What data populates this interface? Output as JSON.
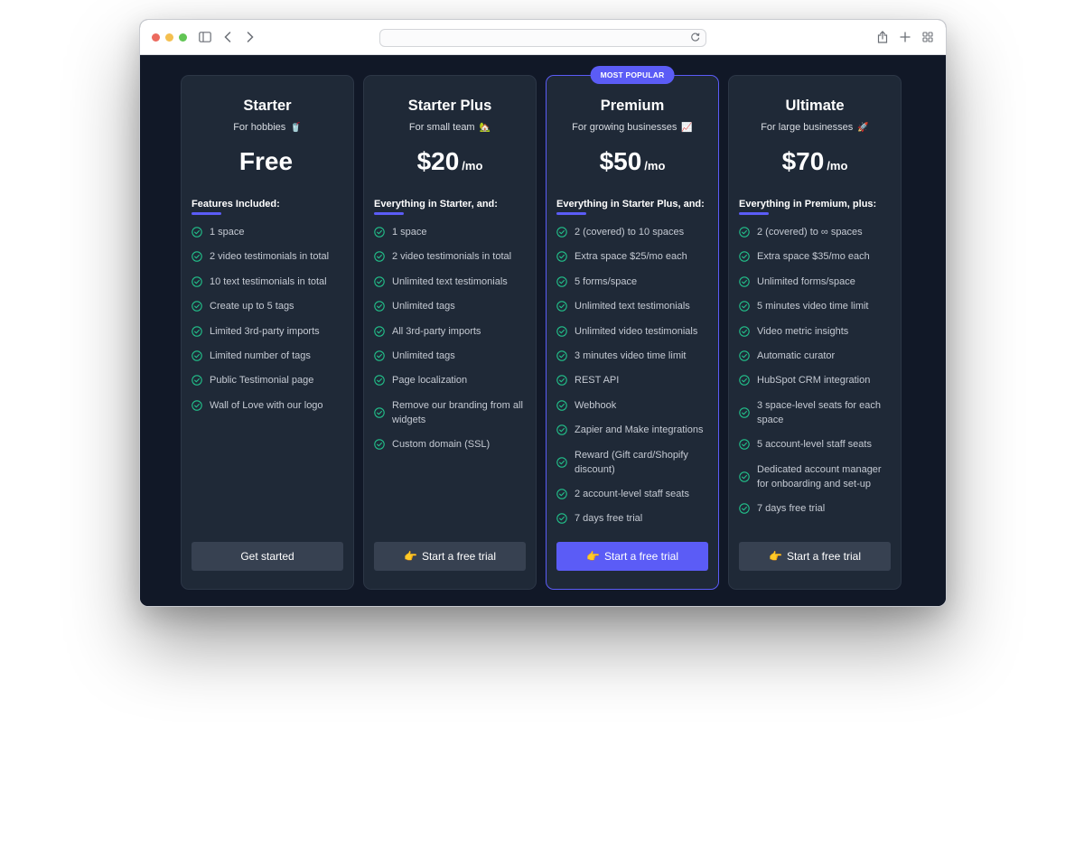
{
  "browser": {
    "icons": [
      "sidebar-icon",
      "back-icon",
      "forward-icon",
      "reload-icon",
      "share-icon",
      "new-tab-icon",
      "tab-overview-icon"
    ]
  },
  "colors": {
    "accent": "#5b5cf6",
    "check": "#22c08a",
    "page_bg": "#111827",
    "card_bg": "#1f2937",
    "button_bg": "#374151"
  },
  "plans": [
    {
      "name": "Starter",
      "subtitle": "For hobbies",
      "emoji": "🥤",
      "price": "Free",
      "period": "",
      "features_heading": "Features Included:",
      "features": [
        "1 space",
        "2 video testimonials in total",
        "10 text testimonials in total",
        "Create up to 5 tags",
        "Limited 3rd-party imports",
        "Limited number of tags",
        "Public Testimonial page",
        "Wall of Love with our logo"
      ],
      "cta_emoji": "",
      "cta_label": "Get started",
      "badge": ""
    },
    {
      "name": "Starter Plus",
      "subtitle": "For small team",
      "emoji": "🏡",
      "price": "$20",
      "period": "/mo",
      "features_heading": "Everything in Starter, and:",
      "features": [
        "1 space",
        "2 video testimonials in total",
        "Unlimited text testimonials",
        "Unlimited tags",
        "All 3rd-party imports",
        "Unlimited tags",
        "Page localization",
        "Remove our branding from all widgets",
        "Custom domain (SSL)"
      ],
      "cta_emoji": "👉",
      "cta_label": "Start a free trial",
      "badge": ""
    },
    {
      "name": "Premium",
      "subtitle": "For growing businesses",
      "emoji": "📈",
      "price": "$50",
      "period": "/mo",
      "features_heading": "Everything in Starter Plus, and:",
      "features": [
        "2 (covered) to 10 spaces",
        "Extra space $25/mo each",
        "5 forms/space",
        "Unlimited text testimonials",
        "Unlimited video testimonials",
        "3 minutes video time limit",
        "REST API",
        "Webhook",
        "Zapier and Make integrations",
        "Reward (Gift card/Shopify discount)",
        "2 account-level staff seats",
        "7 days free trial"
      ],
      "cta_emoji": "👉",
      "cta_label": "Start a free trial",
      "badge": "MOST POPULAR"
    },
    {
      "name": "Ultimate",
      "subtitle": "For large businesses",
      "emoji": "🚀",
      "price": "$70",
      "period": "/mo",
      "features_heading": "Everything in Premium, plus:",
      "features": [
        "2 (covered) to ∞ spaces",
        "Extra space $35/mo each",
        "Unlimited forms/space",
        "5 minutes video time limit",
        "Video metric insights",
        "Automatic curator",
        "HubSpot CRM integration",
        "3 space-level seats for each space",
        "5 account-level staff seats",
        "Dedicated account manager for onboarding and set-up",
        "7 days free trial"
      ],
      "cta_emoji": "👉",
      "cta_label": "Start a free trial",
      "badge": ""
    }
  ]
}
